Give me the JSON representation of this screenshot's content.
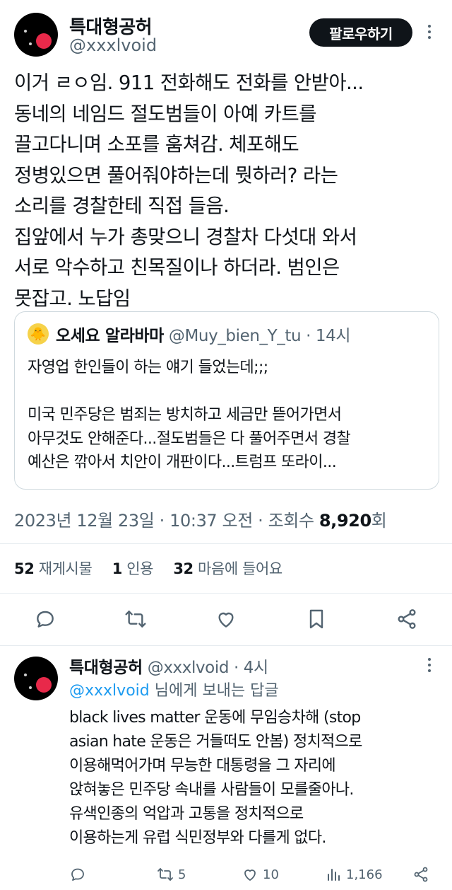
{
  "tweet": {
    "author_name": "특대형공허",
    "author_handle": "@xxxlvoid",
    "follow_label": "팔로우하기",
    "text_lines": [
      "이거 ㄹㅇ임. 911 전화해도 전화를 안받아...",
      "동네의 네임드 절도범들이 아예 카트를",
      "끌고다니며 소포를 훔쳐감. 체포해도",
      "정병있으면 풀어줘야하는데 뭣하러? 라는",
      "소리를 경찰한테 직접 들음.",
      "집앞에서 누가 총맞으니 경찰차 다섯대 와서",
      "서로 악수하고 친목질이나 하더라. 범인은",
      "못잡고. 노답임"
    ],
    "quote": {
      "author_name": "오세요 알라바마",
      "author_handle": "@Muy_bien_Y_tu",
      "time": "· 14시",
      "avatar_icon": "cartoon-avatar-icon",
      "text_lines": [
        "자영업 한인들이 하는 얘기 들었는데;;;",
        "",
        "미국 민주당은 범죄는 방치하고 세금만 뜯어가면서",
        "아무것도 안해준다...절도범들은 다 풀어주면서 경찰",
        "예산은 깎아서 치안이 개판이다...트럼프 또라이..."
      ]
    },
    "timestamp": "2023년 12월 23일 · 10:37 오전 · 조회수",
    "views": "8,920",
    "views_suffix": "회",
    "stats": {
      "retweets_count": "52",
      "retweets_label": "재게시물",
      "quotes_count": "1",
      "quotes_label": "인용",
      "likes_count": "32",
      "likes_label": "마음에 들어요"
    }
  },
  "reply": {
    "author_name": "특대형공허",
    "author_handle": "@xxxlvoid",
    "time": "· 4시",
    "reply_to_mention": "@xxxlvoid",
    "reply_to_suffix": " 님에게 보내는 답글",
    "text_lines": [
      "black lives matter 운동에 무임승차해 (stop",
      "asian hate 운동은 거들떠도 안봄) 정치적으로",
      "이용해먹어가며 무능한 대통령을 그 자리에",
      "앉혀놓은 민주당 속내를 사람들이 모를줄아나.",
      "유색인종의 억압과 고통을 정치적으로",
      "이용하는게 유럽 식민정부와 다를게 없다."
    ],
    "retweets": "5",
    "likes": "10",
    "views": "1,166"
  },
  "colors": {
    "text": "#0f1419",
    "secondary": "#536471",
    "link": "#1d9bf0",
    "border": "#cfd9de"
  }
}
